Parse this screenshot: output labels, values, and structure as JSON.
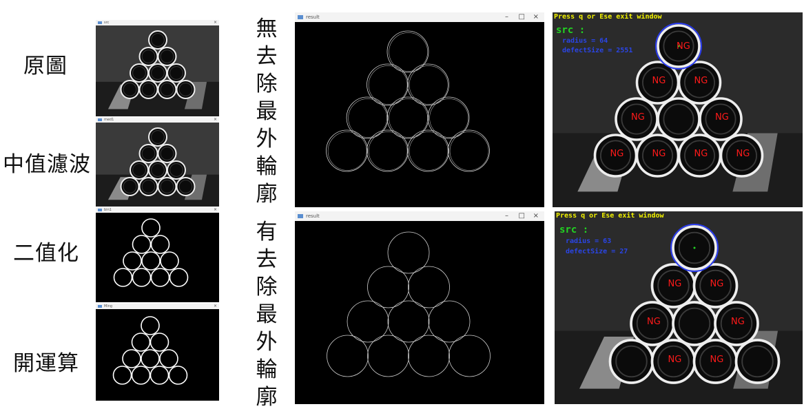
{
  "labels": {
    "original": "原圖",
    "median": "中值濾波",
    "binary": "二值化",
    "opening": "開運算",
    "no_remove": "無去除最外輪廓",
    "with_remove": "有去除最外輪廓"
  },
  "windows": {
    "result_top_title": "result",
    "result_bottom_title": "result",
    "small_titles": [
      "src",
      "med1",
      "bin1",
      "Ming"
    ],
    "ctl_min": "–",
    "ctl_max": "□",
    "ctl_close": "×"
  },
  "detection_top": {
    "header": "Press q or Ese exit window",
    "src_label": "src :",
    "radius_line": "radius = 64",
    "defect_line": "defectSize = 2551",
    "ng_label": "NG"
  },
  "detection_bottom": {
    "header": "Press q or Ese exit window",
    "src_label": "src :",
    "radius_line": "radius = 63",
    "defect_line": "defectSize = 27",
    "ng_label": "NG"
  },
  "colors": {
    "header_text": "#f2f200",
    "src_text": "#22d322",
    "info_text": "#2a45e6",
    "ng_text": "#ff1a1a",
    "circle_highlight": "#2a3cf0"
  }
}
